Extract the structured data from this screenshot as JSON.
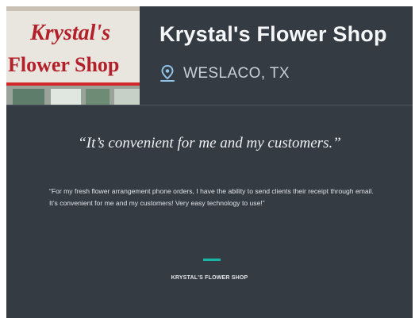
{
  "colors": {
    "background": "#353b42",
    "accent": "#19b5a4",
    "title": "#f4f6f8",
    "location": "#c7d0d8"
  },
  "header": {
    "photo_sign_line1": "Krystal's",
    "photo_sign_line2": "Flower Shop",
    "shop_name": "Krystal's Flower Shop",
    "location_icon": "map-pin-icon",
    "location": "WESLACO, TX"
  },
  "testimonial": {
    "headline": "“It’s convenient for me and my customers.”",
    "body": "“For my fresh flower arrangement phone orders, I have the ability to send clients their receipt through email. It’s convenient for me and my customers! Very easy technology to use!”",
    "attribution": "KRYSTAL'S FLOWER SHOP"
  }
}
